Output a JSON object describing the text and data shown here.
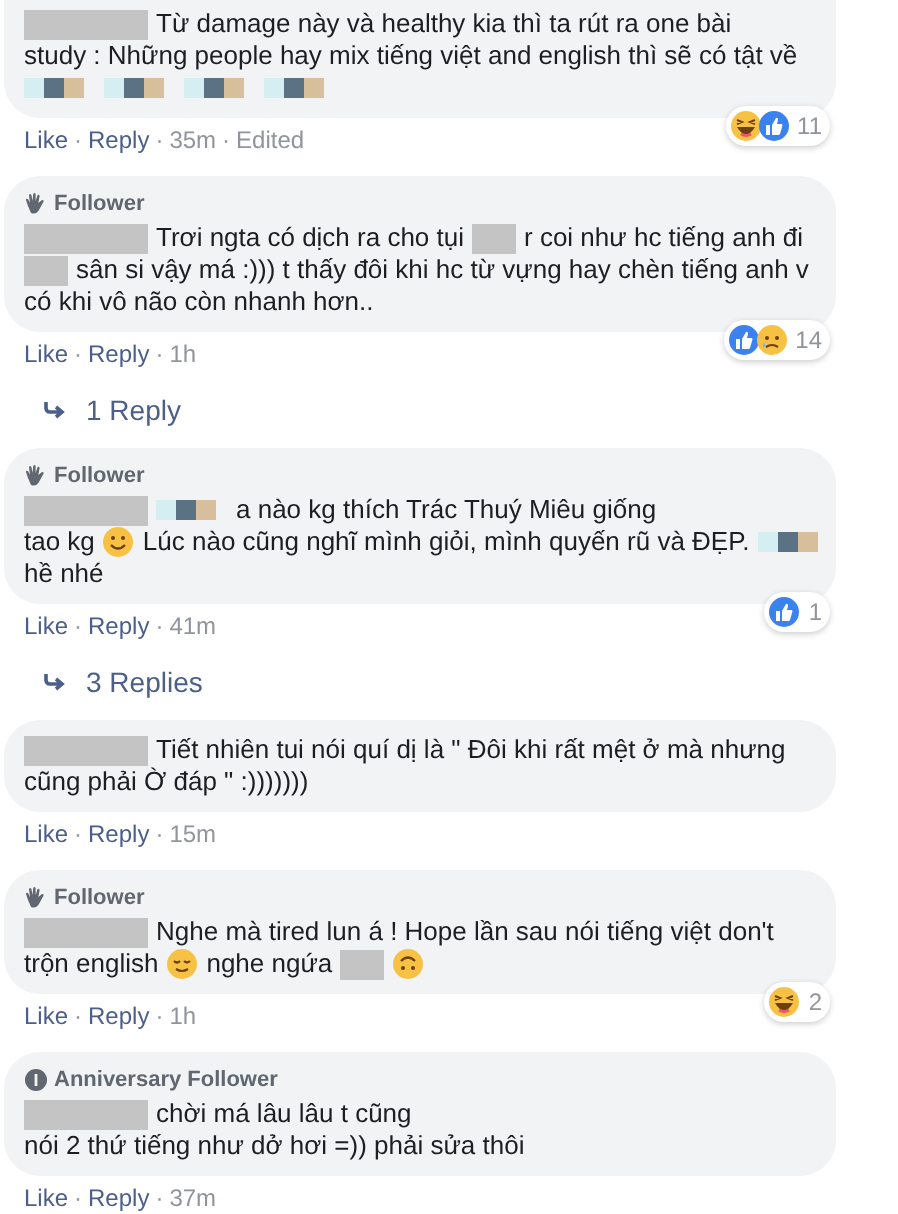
{
  "separator": "·",
  "items": [
    {
      "kind": "comment",
      "top_cut": true,
      "lines": [
        [
          {
            "kind": "redaction"
          },
          {
            "kind": "text",
            "text": "Từ damage này và healthy kia thì ta rút ra one bài"
          }
        ],
        [
          {
            "kind": "text",
            "text": "study : Những people hay mix tiếng việt and english thì sẽ có tật về"
          }
        ],
        [
          {
            "kind": "mosaic"
          },
          {
            "kind": "mosaic"
          },
          {
            "kind": "mosaic"
          },
          {
            "kind": "mosaic"
          }
        ]
      ],
      "reactions": {
        "icons": [
          {
            "kind": "haha"
          },
          {
            "kind": "like"
          }
        ],
        "count": "11"
      },
      "actions": [
        {
          "kind": "link",
          "text": "Like"
        },
        {
          "kind": "link",
          "text": "Reply"
        },
        {
          "kind": "meta",
          "text": "35m"
        },
        {
          "kind": "meta",
          "text": "Edited"
        }
      ]
    },
    {
      "kind": "comment",
      "top_cut": false,
      "badge": {
        "kind": "follower",
        "label": "Follower"
      },
      "lines": [
        [
          {
            "kind": "redaction"
          },
          {
            "kind": "text",
            "text": "Trơi ngta có dịch ra cho tụi"
          },
          {
            "kind": "blur"
          },
          {
            "kind": "text",
            "text": "r coi như hc tiếng anh đi"
          }
        ],
        [
          {
            "kind": "blur"
          },
          {
            "kind": "text",
            "text": "sân si vậy má :))) t thấy đôi khi hc từ vựng hay chèn tiếng anh v"
          }
        ],
        [
          {
            "kind": "text",
            "text": "có khi vô não còn nhanh hơn.."
          }
        ]
      ],
      "reactions": {
        "icons": [
          {
            "kind": "like"
          },
          {
            "kind": "sad"
          }
        ],
        "count": "14"
      },
      "actions": [
        {
          "kind": "link",
          "text": "Like"
        },
        {
          "kind": "link",
          "text": "Reply"
        },
        {
          "kind": "meta",
          "text": "1h"
        }
      ]
    },
    {
      "kind": "replies",
      "text": "1 Reply"
    },
    {
      "kind": "comment",
      "top_cut": false,
      "badge": {
        "kind": "follower",
        "label": "Follower"
      },
      "lines": [
        [
          {
            "kind": "redaction"
          },
          {
            "kind": "mosaic"
          },
          {
            "kind": "text",
            "text": "a nào kg thích Trác Thuý Miêu giống"
          }
        ],
        [
          {
            "kind": "text",
            "text": "tao kg"
          },
          {
            "kind": "smile"
          },
          {
            "kind": "text",
            "text": "Lúc nào cũng nghĩ mình giỏi, mình quyến rũ và ĐẸP."
          },
          {
            "kind": "mosaic"
          }
        ],
        [
          {
            "kind": "text",
            "text": "hề nhé"
          }
        ]
      ],
      "reactions": {
        "icons": [
          {
            "kind": "like"
          }
        ],
        "count": "1"
      },
      "actions": [
        {
          "kind": "link",
          "text": "Like"
        },
        {
          "kind": "link",
          "text": "Reply"
        },
        {
          "kind": "meta",
          "text": "41m"
        }
      ]
    },
    {
      "kind": "replies",
      "text": "3 Replies"
    },
    {
      "kind": "comment",
      "top_cut": false,
      "lines": [
        [
          {
            "kind": "redaction"
          },
          {
            "kind": "text",
            "text": "Tiết nhiên tui nói quí dị là \" Đôi khi rất mệt ở mà nhưng"
          }
        ],
        [
          {
            "kind": "text",
            "text": "cũng phải Ờ đáp \" :)))))))"
          }
        ]
      ],
      "actions": [
        {
          "kind": "link",
          "text": "Like"
        },
        {
          "kind": "link",
          "text": "Reply"
        },
        {
          "kind": "meta",
          "text": "15m"
        }
      ]
    },
    {
      "kind": "comment",
      "top_cut": false,
      "badge": {
        "kind": "follower",
        "label": "Follower"
      },
      "lines": [
        [
          {
            "kind": "redaction"
          },
          {
            "kind": "text",
            "text": "Nghe mà tired lun á ! Hope lần sau nói tiếng việt don't"
          }
        ],
        [
          {
            "kind": "text",
            "text": "trộn english"
          },
          {
            "kind": "relieved"
          },
          {
            "kind": "text",
            "text": "nghe ngứa"
          },
          {
            "kind": "blur"
          },
          {
            "kind": "upside"
          }
        ]
      ],
      "reactions": {
        "icons": [
          {
            "kind": "haha"
          }
        ],
        "count": "2"
      },
      "actions": [
        {
          "kind": "link",
          "text": "Like"
        },
        {
          "kind": "link",
          "text": "Reply"
        },
        {
          "kind": "meta",
          "text": "1h"
        }
      ]
    },
    {
      "kind": "comment",
      "top_cut": false,
      "badge": {
        "kind": "anniversary",
        "label": "Anniversary Follower"
      },
      "lines": [
        [
          {
            "kind": "redaction"
          },
          {
            "kind": "text",
            "text": "chời má lâu lâu t cũng"
          }
        ],
        [
          {
            "kind": "text",
            "text": "nói 2 thứ tiếng như dở hơi =)) phải sửa thôi"
          }
        ]
      ],
      "actions": [
        {
          "kind": "link",
          "text": "Like"
        },
        {
          "kind": "link",
          "text": "Reply"
        },
        {
          "kind": "meta",
          "text": "37m"
        }
      ]
    }
  ]
}
